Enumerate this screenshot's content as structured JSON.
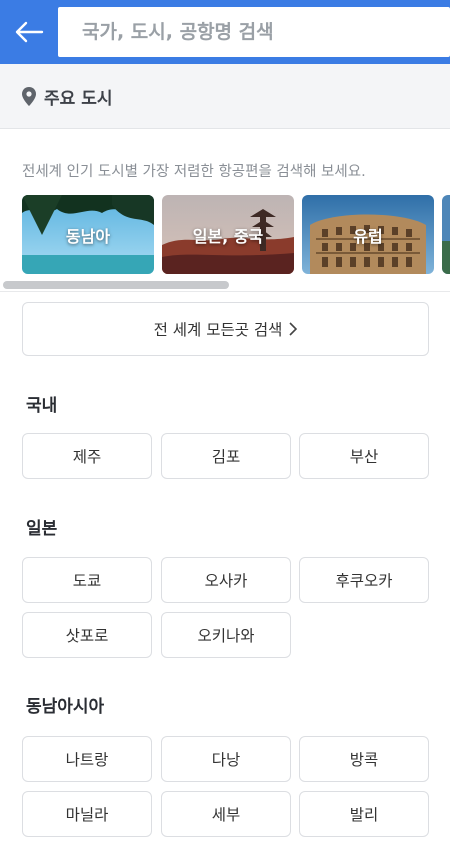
{
  "header": {
    "search_placeholder": "국가, 도시, 공항명 검색",
    "back_icon": "arrow-left-icon",
    "background_color": "#3b7ce4"
  },
  "section": {
    "icon": "location-pin-icon",
    "title": "주요 도시"
  },
  "intro_text": "전세계 인기 도시별 가장 저렴한 항공편을 검색해 보세요.",
  "regions": [
    {
      "label": "동남아"
    },
    {
      "label": "일본, 중국"
    },
    {
      "label": "유럽"
    },
    {
      "label": ""
    }
  ],
  "search_all": {
    "label": "전 세계 모든곳 검색",
    "icon": "chevron-right-icon"
  },
  "groups": [
    {
      "title": "국내",
      "cities": [
        "제주",
        "김포",
        "부산"
      ]
    },
    {
      "title": "일본",
      "cities": [
        "도쿄",
        "오사카",
        "후쿠오카",
        "삿포로",
        "오키나와"
      ]
    },
    {
      "title": "동남아시아",
      "cities": [
        "나트랑",
        "다낭",
        "방콕",
        "마닐라",
        "세부",
        "발리"
      ]
    }
  ]
}
